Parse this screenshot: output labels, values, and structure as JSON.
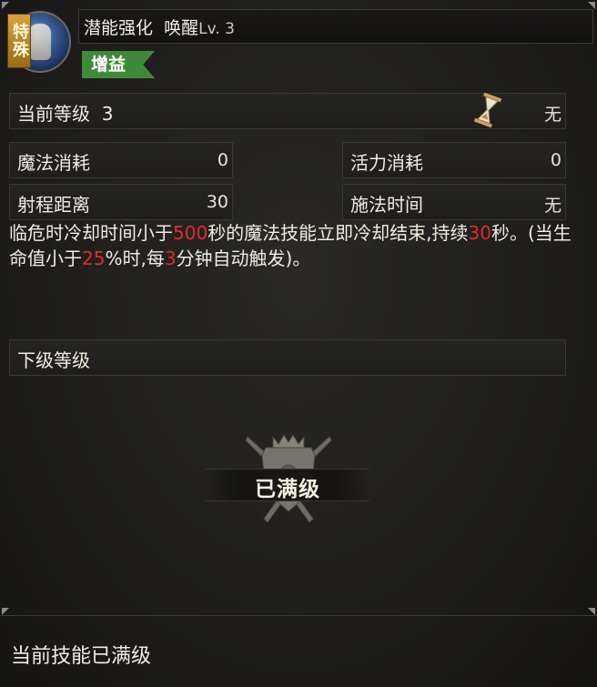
{
  "header": {
    "special_tag": "特殊",
    "skill_name": "潜能强化",
    "awaken_label": "唤醒",
    "level_text": "Lv. 3",
    "buff_tag": "增益"
  },
  "current_level": {
    "label": "当前等级",
    "value": "3",
    "cooldown_value": "无"
  },
  "stats": {
    "mana_cost": {
      "label": "魔法消耗",
      "value": "0"
    },
    "vitality_cost": {
      "label": "活力消耗",
      "value": "0"
    },
    "cast_range": {
      "label": "射程距离",
      "value": "30"
    },
    "cast_time": {
      "label": "施法时间",
      "value": "无"
    }
  },
  "description": {
    "p1": "临危时冷却时间小于",
    "n1": "500",
    "p2": "秒的魔法技能立即冷却结束,持续",
    "n2": "30",
    "p3": "秒。(当生命值小于",
    "n3": "25",
    "p4": "%时,每",
    "n4": "3",
    "p5": "分钟自动触发)。"
  },
  "next_level": {
    "label": "下级等级",
    "maxed_text": "已满级"
  },
  "footer": {
    "text": "当前技能已满级"
  },
  "colors": {
    "highlight": "#e02a2a",
    "buff_green": "#3f8a3a",
    "special_gold": "#d8a43c"
  },
  "icons": [
    "hero-portrait-icon",
    "hourglass-icon",
    "crossed-swords-emblem-icon"
  ]
}
